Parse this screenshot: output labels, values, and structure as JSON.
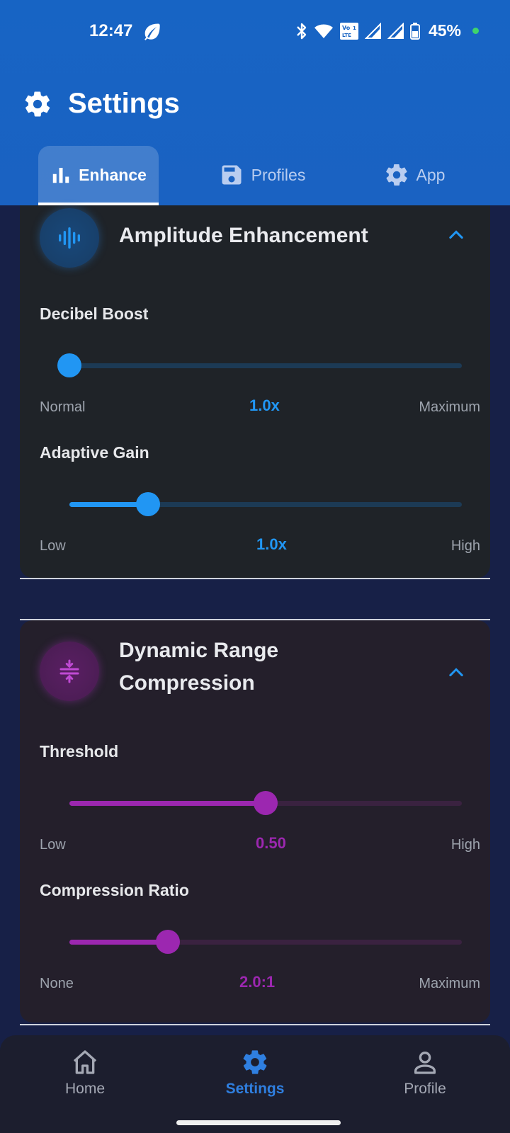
{
  "status_bar": {
    "time": "12:47",
    "battery": "45%",
    "icons": [
      "leaf-icon",
      "bluetooth-icon",
      "wifi-icon",
      "volte-icon",
      "signal-icon",
      "signal-icon",
      "battery-icon"
    ]
  },
  "header": {
    "title": "Settings",
    "icon": "gear-icon"
  },
  "tabs": [
    {
      "label": "Enhance",
      "icon": "bar-chart-icon",
      "active": true
    },
    {
      "label": "Profiles",
      "icon": "save-icon",
      "active": false
    },
    {
      "label": "App",
      "icon": "gear-icon",
      "active": false
    }
  ],
  "sections": {
    "amplitude": {
      "title": "Amplitude Enhancement",
      "icon": "waveform-icon",
      "color": "#2196f3",
      "settings": [
        {
          "label": "Decibel Boost",
          "min_label": "Normal",
          "max_label": "Maximum",
          "value": "1.0x",
          "fraction": 0.0
        },
        {
          "label": "Adaptive Gain",
          "min_label": "Low",
          "max_label": "High",
          "value": "1.0x",
          "fraction": 0.2
        }
      ]
    },
    "compression": {
      "title": "Dynamic Range Compression",
      "icon": "compress-icon",
      "color": "#9c27b0",
      "settings": [
        {
          "label": "Threshold",
          "min_label": "Low",
          "max_label": "High",
          "value": "0.50",
          "fraction": 0.5
        },
        {
          "label": "Compression Ratio",
          "min_label": "None",
          "max_label": "Maximum",
          "value": "2.0:1",
          "fraction": 0.25
        }
      ]
    }
  },
  "bottom_nav": [
    {
      "label": "Home",
      "icon": "home-icon",
      "active": false
    },
    {
      "label": "Settings",
      "icon": "gear-icon",
      "active": true
    },
    {
      "label": "Profile",
      "icon": "person-icon",
      "active": false
    }
  ]
}
